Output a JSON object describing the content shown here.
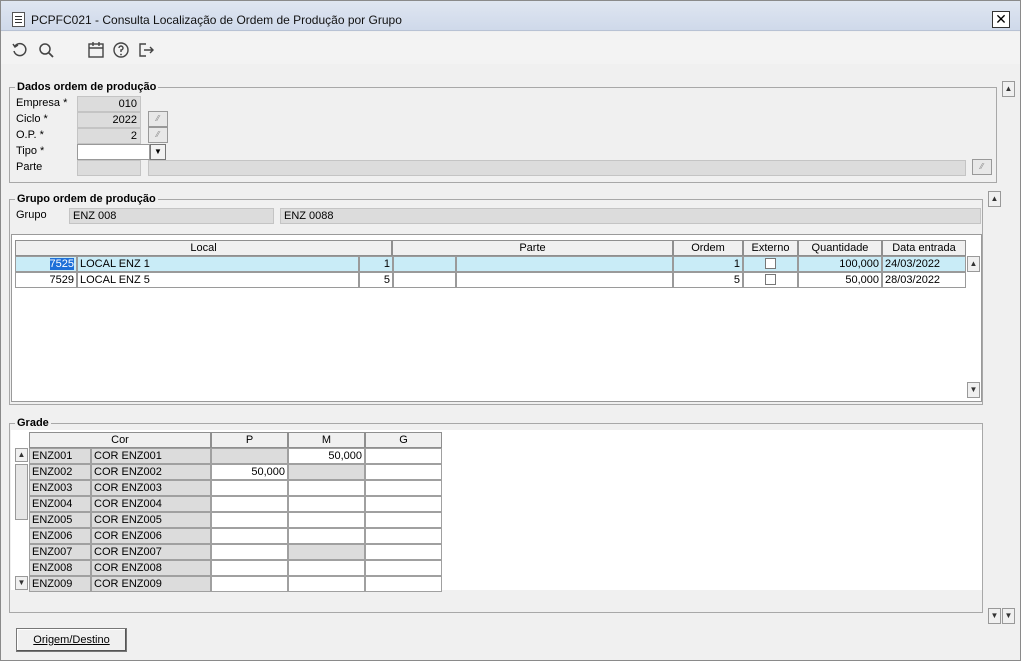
{
  "window": {
    "title": "PCPFC021 - Consulta Localização de Ordem de Produção por Grupo",
    "close_label": "✕"
  },
  "toolbar": {
    "icons": [
      "refresh-icon",
      "search-icon",
      "calendar-icon",
      "help-icon",
      "exit-icon"
    ]
  },
  "dados": {
    "title": "Dados ordem de produção",
    "empresa_label": "Empresa *",
    "empresa_value": "010",
    "ciclo_label": "Ciclo *",
    "ciclo_value": "2022",
    "op_label": "O.P. *",
    "op_value": "2",
    "tipo_label": "Tipo *",
    "tipo_value": "",
    "parte_label": "Parte",
    "parte_code": "",
    "parte_desc": ""
  },
  "grupo": {
    "title": "Grupo ordem de produção",
    "label": "Grupo",
    "code": "ENZ 008",
    "desc": "ENZ 0088"
  },
  "table": {
    "headers": {
      "local": "Local",
      "parte": "Parte",
      "ordem": "Ordem",
      "externo": "Externo",
      "quantidade": "Quantidade",
      "data_entrada": "Data entrada"
    },
    "rows": [
      {
        "code": "7525",
        "name": "LOCAL ENZ  1",
        "seq": "1",
        "parte_a": "",
        "parte_b": "",
        "ordem": "1",
        "externo": false,
        "quantidade": "100,000",
        "data": "24/03/2022"
      },
      {
        "code": "7529",
        "name": "LOCAL ENZ 5",
        "seq": "5",
        "parte_a": "",
        "parte_b": "",
        "ordem": "5",
        "externo": false,
        "quantidade": "50,000",
        "data": "28/03/2022"
      }
    ]
  },
  "grade": {
    "title": "Grade",
    "headers": {
      "cor": "Cor",
      "p": "P",
      "m": "M",
      "g": "G"
    },
    "rows": [
      {
        "code": "ENZ001",
        "name": "COR ENZ001",
        "p": "",
        "m": "50,000",
        "g": ""
      },
      {
        "code": "ENZ002",
        "name": "COR ENZ002",
        "p": "50,000",
        "m": "",
        "g": ""
      },
      {
        "code": "ENZ003",
        "name": "COR ENZ003",
        "p": "",
        "m": "",
        "g": ""
      },
      {
        "code": "ENZ004",
        "name": "COR ENZ004",
        "p": "",
        "m": "",
        "g": ""
      },
      {
        "code": "ENZ005",
        "name": "COR ENZ005",
        "p": "",
        "m": "",
        "g": ""
      },
      {
        "code": "ENZ006",
        "name": "COR ENZ006",
        "p": "",
        "m": "",
        "g": ""
      },
      {
        "code": "ENZ007",
        "name": "COR ENZ007",
        "p": "",
        "m": "",
        "g": ""
      },
      {
        "code": "ENZ008",
        "name": "COR ENZ008",
        "p": "",
        "m": "",
        "g": ""
      },
      {
        "code": "ENZ009",
        "name": "COR ENZ009",
        "p": "",
        "m": "",
        "g": ""
      }
    ]
  },
  "buttons": {
    "origem_destino": "Origem/Destino"
  },
  "colors": {
    "selection": "#c9ecf7",
    "readonly_field": "#dcdcdc",
    "titlebar": "#d6dfee"
  }
}
